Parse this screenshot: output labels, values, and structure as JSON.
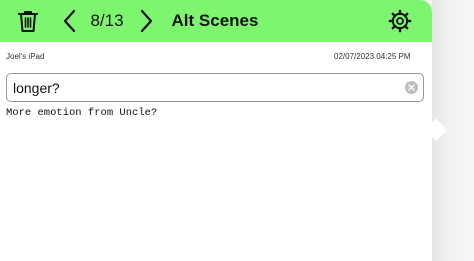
{
  "header": {
    "counter": "8/13",
    "title": "Alt Scenes",
    "background_color": "#7df56f",
    "icons": {
      "delete": "trash-icon",
      "previous": "chevron-left-icon",
      "next": "chevron-right-icon",
      "settings": "gear-icon"
    }
  },
  "meta": {
    "device": "Joel's iPad",
    "timestamp": "02/07/2023 04:25 PM"
  },
  "scene": {
    "title_value": "longer?",
    "notes": "More emotion from Uncle?"
  }
}
